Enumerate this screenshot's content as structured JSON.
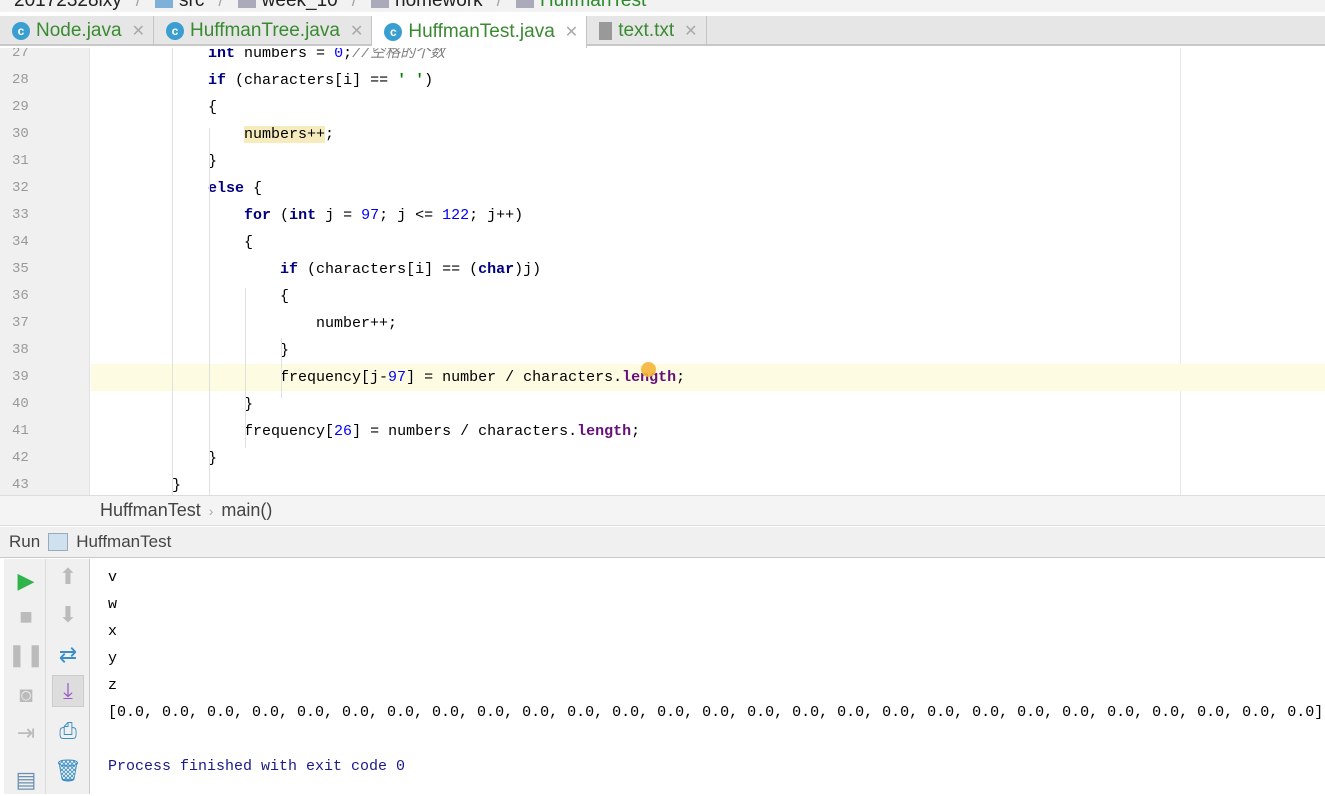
{
  "breadcrumb": [
    "20172328lxy",
    "src",
    "week_10",
    "homework",
    "HuffmanTest"
  ],
  "tabs": [
    {
      "label": "Node.java",
      "icon": "class-icon",
      "active": false
    },
    {
      "label": "HuffmanTree.java",
      "icon": "class-icon",
      "active": false
    },
    {
      "label": "HuffmanTest.java",
      "icon": "runnable-class-icon",
      "active": true
    },
    {
      "label": "text.txt",
      "icon": "text-file-icon",
      "active": false
    }
  ],
  "editor": {
    "lines": [
      {
        "n": "27",
        "seg": [
          [
            "            ",
            ""
          ],
          [
            "int",
            "kw"
          ],
          [
            " numbers = ",
            ""
          ],
          [
            "0",
            "num"
          ],
          [
            ";",
            ""
          ],
          [
            "//空格的个数",
            "cm"
          ]
        ]
      },
      {
        "n": "28",
        "seg": [
          [
            "            ",
            ""
          ],
          [
            "if",
            "kw"
          ],
          [
            " (characters[i] == ",
            ""
          ],
          [
            "' '",
            "str"
          ],
          [
            ")",
            ""
          ]
        ]
      },
      {
        "n": "29",
        "seg": [
          [
            "            {",
            ""
          ]
        ]
      },
      {
        "n": "30",
        "seg": [
          [
            "                ",
            ""
          ],
          [
            "numbers++",
            "mark"
          ],
          [
            ";",
            ""
          ]
        ]
      },
      {
        "n": "31",
        "seg": [
          [
            "            }",
            ""
          ]
        ]
      },
      {
        "n": "32",
        "seg": [
          [
            "            ",
            ""
          ],
          [
            "else",
            "kw"
          ],
          [
            " {",
            ""
          ]
        ]
      },
      {
        "n": "33",
        "seg": [
          [
            "                ",
            ""
          ],
          [
            "for",
            "kw"
          ],
          [
            " (",
            ""
          ],
          [
            "int",
            "kw"
          ],
          [
            " j = ",
            ""
          ],
          [
            "97",
            "num"
          ],
          [
            "; j <= ",
            ""
          ],
          [
            "122",
            "num"
          ],
          [
            "; j++)",
            ""
          ]
        ]
      },
      {
        "n": "34",
        "seg": [
          [
            "                {",
            ""
          ]
        ]
      },
      {
        "n": "35",
        "seg": [
          [
            "                    ",
            ""
          ],
          [
            "if",
            "kw"
          ],
          [
            " (characters[i] == (",
            ""
          ],
          [
            "char",
            "kw"
          ],
          [
            ")j)",
            ""
          ]
        ]
      },
      {
        "n": "36",
        "seg": [
          [
            "                    {",
            ""
          ]
        ]
      },
      {
        "n": "37",
        "seg": [
          [
            "                        number++;",
            ""
          ]
        ]
      },
      {
        "n": "38",
        "seg": [
          [
            "                    }",
            ""
          ]
        ]
      },
      {
        "n": "39",
        "seg": [
          [
            "                    frequency[j-",
            ""
          ],
          [
            "97",
            "num"
          ],
          [
            "] = number / characters.",
            ""
          ],
          [
            "length",
            "fld"
          ],
          [
            ";",
            ""
          ]
        ]
      },
      {
        "n": "40",
        "seg": [
          [
            "                }",
            ""
          ]
        ]
      },
      {
        "n": "41",
        "seg": [
          [
            "                frequency[",
            ""
          ],
          [
            "26",
            "num"
          ],
          [
            "] = numbers / characters.",
            ""
          ],
          [
            "length",
            "fld"
          ],
          [
            ";",
            ""
          ]
        ]
      },
      {
        "n": "42",
        "seg": [
          [
            "            }",
            ""
          ]
        ]
      },
      {
        "n": "43",
        "seg": [
          [
            "        }",
            ""
          ]
        ]
      }
    ],
    "current_line": "39"
  },
  "navbar": {
    "class": "HuffmanTest",
    "method": "main()",
    "separator": "›"
  },
  "run": {
    "label": "Run",
    "config": "HuffmanTest"
  },
  "console": {
    "lines": [
      "v",
      "w",
      "x",
      "y",
      "z",
      "[0.0, 0.0, 0.0, 0.0, 0.0, 0.0, 0.0, 0.0, 0.0, 0.0, 0.0, 0.0, 0.0, 0.0, 0.0, 0.0, 0.0, 0.0, 0.0, 0.0, 0.0, 0.0, 0.0, 0.0, 0.0, 0.0, 0.0]",
      "",
      "Process finished with exit code 0"
    ]
  },
  "colors": {
    "keyword": "#000080",
    "number": "#0000ff",
    "string": "#008000",
    "tab_text": "#3a8a32",
    "run_green": "#2fb34a"
  }
}
